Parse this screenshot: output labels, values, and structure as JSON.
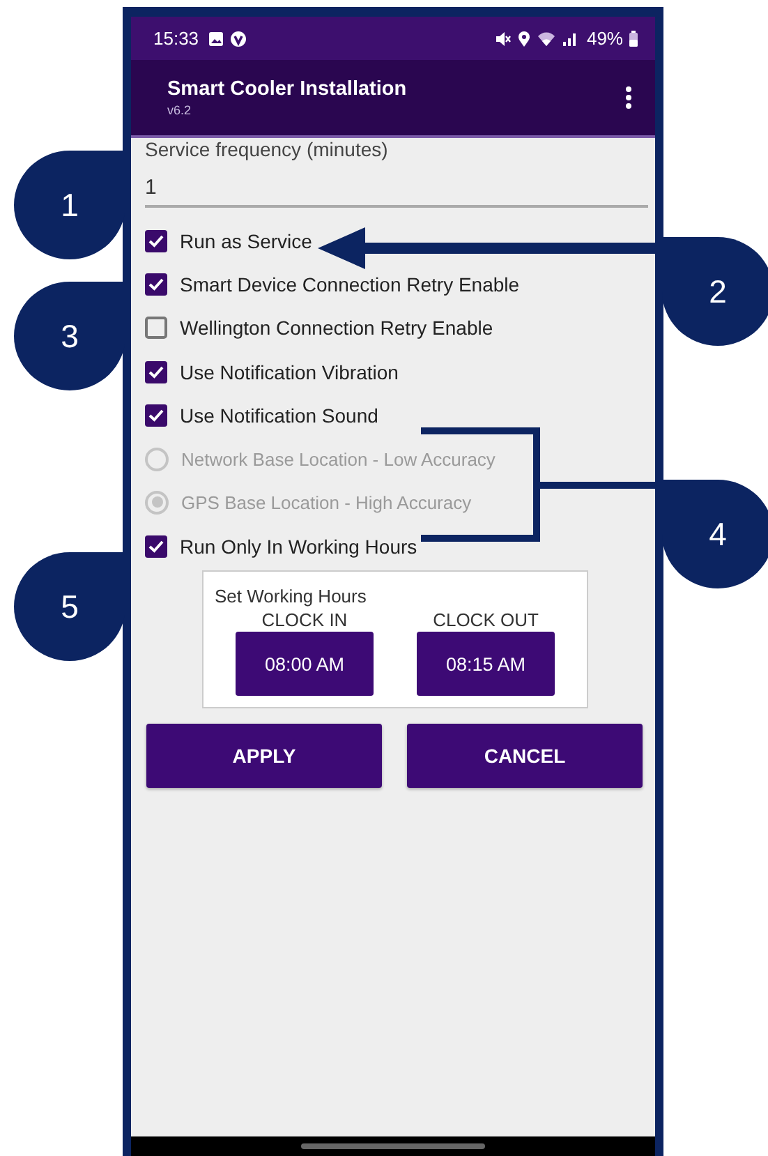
{
  "status_bar": {
    "time": "15:33",
    "battery": "49%"
  },
  "app_bar": {
    "title": "Smart Cooler Installation",
    "version": "v6.2"
  },
  "service_frequency": {
    "label": "Service frequency (minutes)",
    "value": "1"
  },
  "options": [
    {
      "kind": "checkbox",
      "label": "Run as Service",
      "checked": true,
      "disabled": false
    },
    {
      "kind": "checkbox",
      "label": "Smart Device Connection Retry Enable",
      "checked": true,
      "disabled": false
    },
    {
      "kind": "checkbox",
      "label": "Wellington Connection Retry Enable",
      "checked": false,
      "disabled": false
    },
    {
      "kind": "checkbox",
      "label": "Use Notification Vibration",
      "checked": true,
      "disabled": false
    },
    {
      "kind": "checkbox",
      "label": "Use Notification Sound",
      "checked": true,
      "disabled": false
    },
    {
      "kind": "radio",
      "label": "Network Base Location - Low Accuracy",
      "selected": false,
      "disabled": true
    },
    {
      "kind": "radio",
      "label": "GPS Base Location - High Accuracy",
      "selected": true,
      "disabled": true
    },
    {
      "kind": "checkbox",
      "label": "Run Only In Working Hours",
      "checked": true,
      "disabled": false
    }
  ],
  "working_hours": {
    "title": "Set Working Hours",
    "clocks": [
      {
        "label": "CLOCK IN",
        "value": "08:00 AM"
      },
      {
        "label": "CLOCK OUT",
        "value": "08:15 AM"
      }
    ]
  },
  "buttons": [
    "APPLY",
    "CANCEL"
  ],
  "callouts": [
    {
      "number": "1"
    },
    {
      "number": "2"
    },
    {
      "number": "3"
    },
    {
      "number": "4"
    },
    {
      "number": "5"
    }
  ]
}
